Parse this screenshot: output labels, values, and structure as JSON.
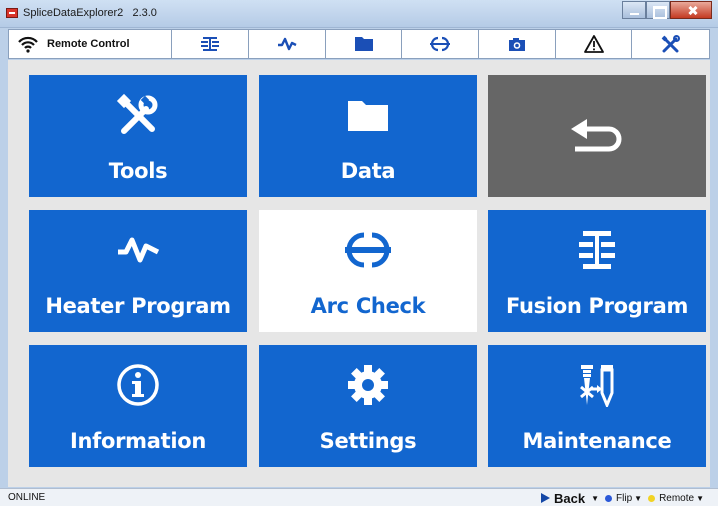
{
  "window": {
    "title": "SpliceDataExplorer2",
    "version": "2.3.0"
  },
  "toolbar": {
    "remote_label": "Remote Control",
    "buttons": [
      {
        "icon": "fusion-icon"
      },
      {
        "icon": "heater-icon"
      },
      {
        "icon": "folder-icon"
      },
      {
        "icon": "arc-check-icon"
      },
      {
        "icon": "camera-icon"
      },
      {
        "icon": "warning-icon"
      },
      {
        "icon": "tools-icon"
      }
    ]
  },
  "tiles": [
    {
      "label": "Tools",
      "icon": "tools-icon"
    },
    {
      "label": "Data",
      "icon": "folder-icon"
    },
    {
      "label": "",
      "icon": "back-arrow-icon"
    },
    {
      "label": "Heater Program",
      "icon": "heater-icon"
    },
    {
      "label": "Arc Check",
      "icon": "arc-check-icon"
    },
    {
      "label": "Fusion Program",
      "icon": "fusion-icon"
    },
    {
      "label": "Information",
      "icon": "info-icon"
    },
    {
      "label": "Settings",
      "icon": "gear-icon"
    },
    {
      "label": "Maintenance",
      "icon": "maintenance-icon"
    }
  ],
  "status": {
    "text": "ONLINE",
    "back_label": "Back",
    "flip_label": "Flip",
    "remote_label": "Remote"
  },
  "colors": {
    "tile_blue": "#1266cf",
    "tile_grey": "#666666",
    "active_tile": "#ffffff",
    "panel": "#e6e6e6"
  }
}
